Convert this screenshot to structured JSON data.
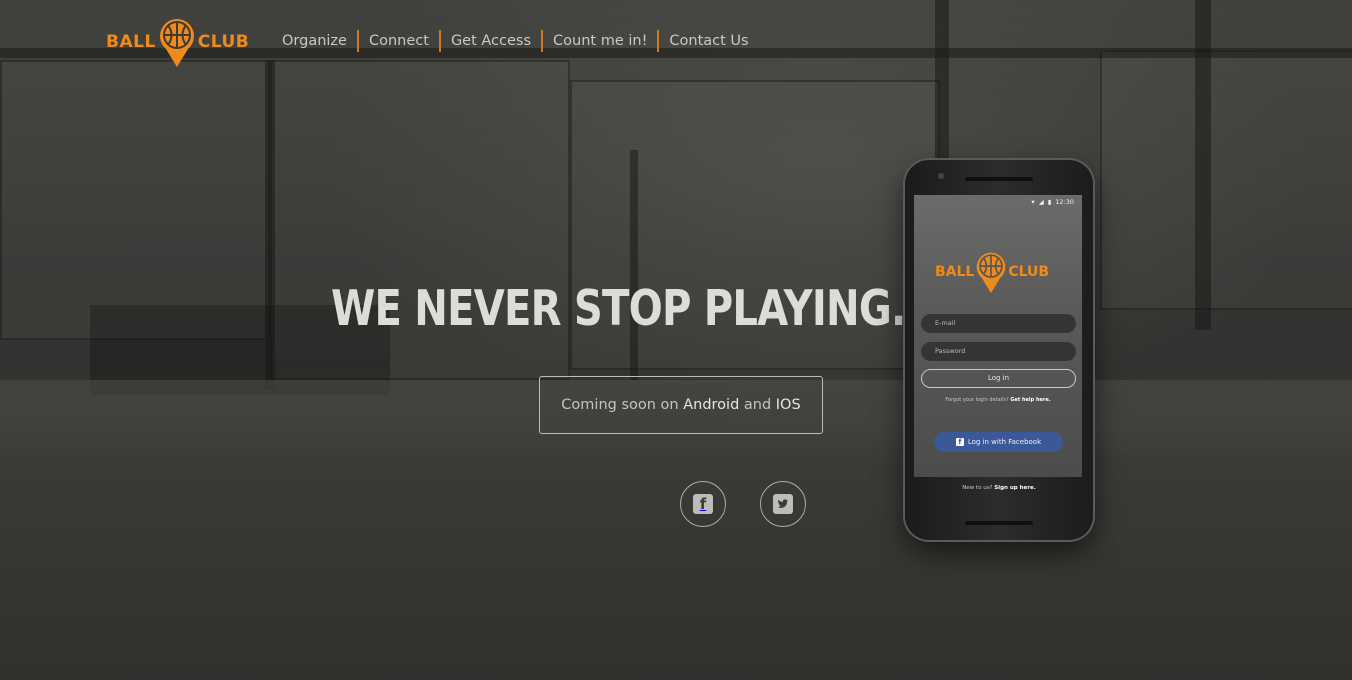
{
  "brand": {
    "logo_left": "BALL",
    "logo_right": "CLUB",
    "accent": "#f08a1c"
  },
  "nav": {
    "items": [
      {
        "label": "Organize"
      },
      {
        "label": "Connect"
      },
      {
        "label": "Get Access"
      },
      {
        "label": "Count me in!"
      },
      {
        "label": "Contact Us"
      }
    ]
  },
  "hero": {
    "title": "WE NEVER STOP PLAYING.",
    "coming_soon_prefix": "Coming soon on",
    "coming_soon_android": "Android",
    "coming_soon_and": "and",
    "coming_soon_ios": "IOS"
  },
  "social": {
    "facebook_icon": "facebook-icon",
    "twitter_icon": "twitter-icon"
  },
  "phone": {
    "time": "12:30",
    "logo_left": "BALL",
    "logo_right": "CLUB",
    "email_placeholder": "E-mail",
    "password_placeholder": "Password",
    "login_label": "Log in",
    "forgot_text": "Forgot your login details?",
    "forgot_link": "Get help here.",
    "facebook_label": "Log in with Facebook",
    "signup_text": "New to us?",
    "signup_link": "Sign up here."
  }
}
